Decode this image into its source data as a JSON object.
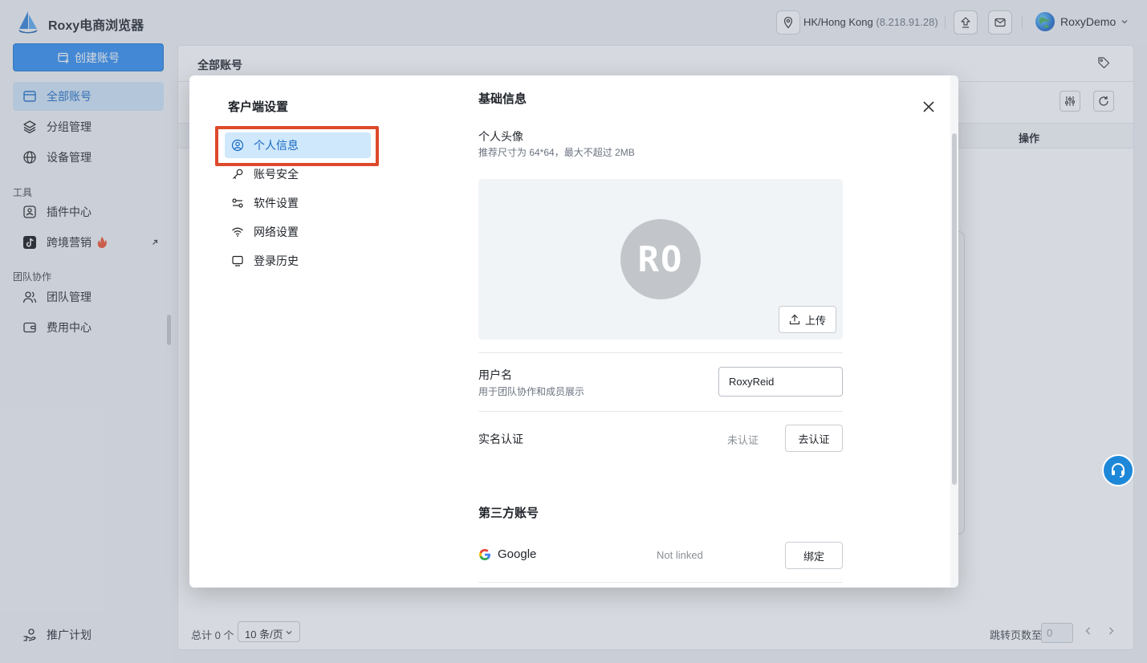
{
  "app": {
    "title": "Roxy电商浏览器"
  },
  "topbar": {
    "location": "HK/Hong Kong",
    "ip": "(8.218.91.28)",
    "user": "RoxyDemo"
  },
  "sidebar": {
    "create_label": "创建账号",
    "items": [
      {
        "label": "全部账号"
      },
      {
        "label": "分组管理"
      },
      {
        "label": "设备管理"
      }
    ],
    "section_tools": "工具",
    "tools": [
      {
        "label": "插件中心"
      },
      {
        "label": "跨境营销"
      }
    ],
    "section_team": "团队协作",
    "team": [
      {
        "label": "团队管理"
      },
      {
        "label": "费用中心"
      }
    ],
    "promo_label": "推广计划"
  },
  "main": {
    "title": "全部账号",
    "op_column": "操作",
    "total_text": "总计 0 个",
    "page_size": "10 条/页",
    "jump_label": "跳转页数至",
    "jump_value": "0"
  },
  "modal": {
    "title": "客户端设置",
    "menu": [
      {
        "label": "个人信息"
      },
      {
        "label": "账号安全"
      },
      {
        "label": "软件设置"
      },
      {
        "label": "网络设置"
      },
      {
        "label": "登录历史"
      }
    ],
    "basic_title": "基础信息",
    "avatar_label": "个人头像",
    "avatar_hint": "推荐尺寸为 64*64，最大不超过 2MB",
    "avatar_initials": "RO",
    "upload_label": "上传",
    "username_label": "用户名",
    "username_hint": "用于团队协作和成员展示",
    "username_value": "RoxyReid",
    "realname_label": "实名认证",
    "realname_status": "未认证",
    "realname_button": "去认证",
    "third_title": "第三方账号",
    "google_label": "Google",
    "google_status": "Not linked",
    "google_button": "绑定"
  }
}
